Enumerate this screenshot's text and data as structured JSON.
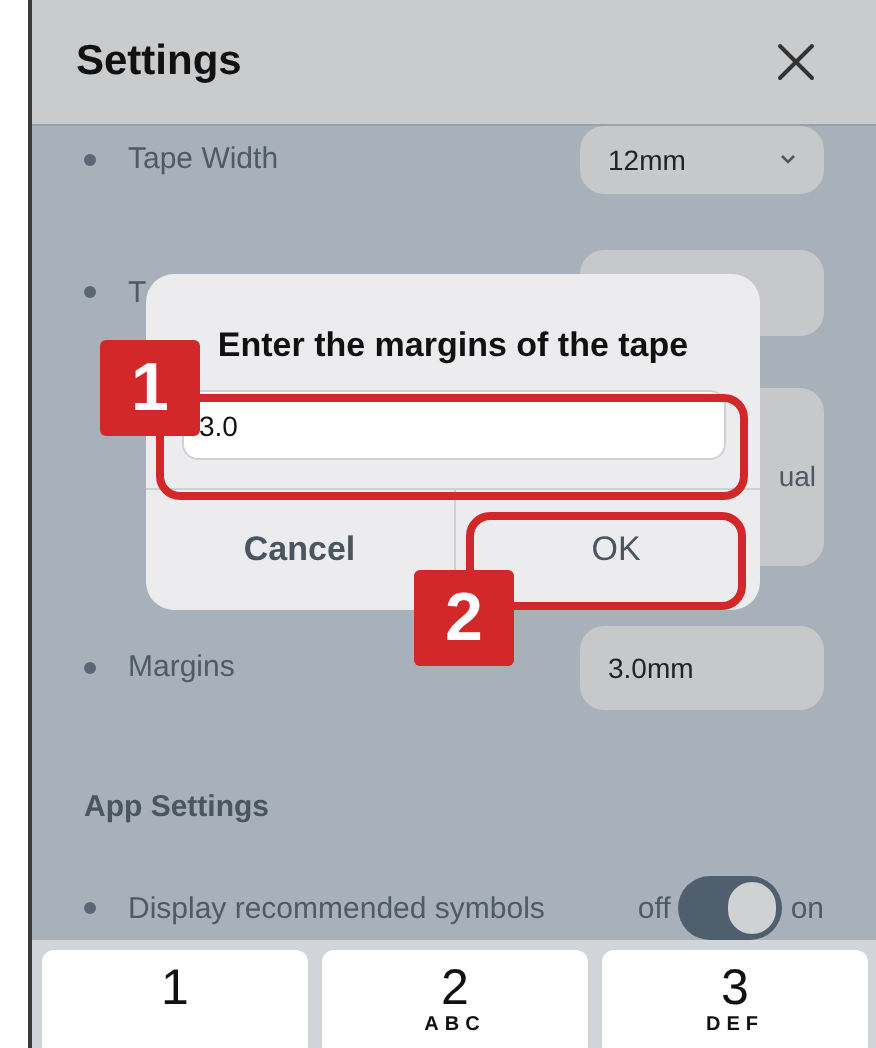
{
  "header": {
    "title": "Settings"
  },
  "settings": [
    {
      "kind": "select",
      "label": "Tape Width",
      "value": "12mm"
    },
    {
      "kind": "field",
      "label": "T"
    },
    {
      "kind": "tall-field",
      "value": "ual"
    },
    {
      "kind": "field",
      "label": "Margins",
      "value": "3.0mm"
    }
  ],
  "app_settings": {
    "heading": "App Settings",
    "rows": [
      {
        "label": "Display recommended symbols",
        "off_label": "off",
        "on_label": "on",
        "on": true
      }
    ]
  },
  "dialog": {
    "title": "Enter the margins of the tape",
    "value": "3.0",
    "buttons": [
      "Cancel",
      "OK"
    ]
  },
  "callouts": [
    {
      "number": "1"
    },
    {
      "number": "2"
    }
  ],
  "keypad": [
    {
      "digit": "1"
    },
    {
      "digit": "2",
      "letters": "ABC"
    },
    {
      "digit": "3",
      "letters": "DEF"
    }
  ]
}
